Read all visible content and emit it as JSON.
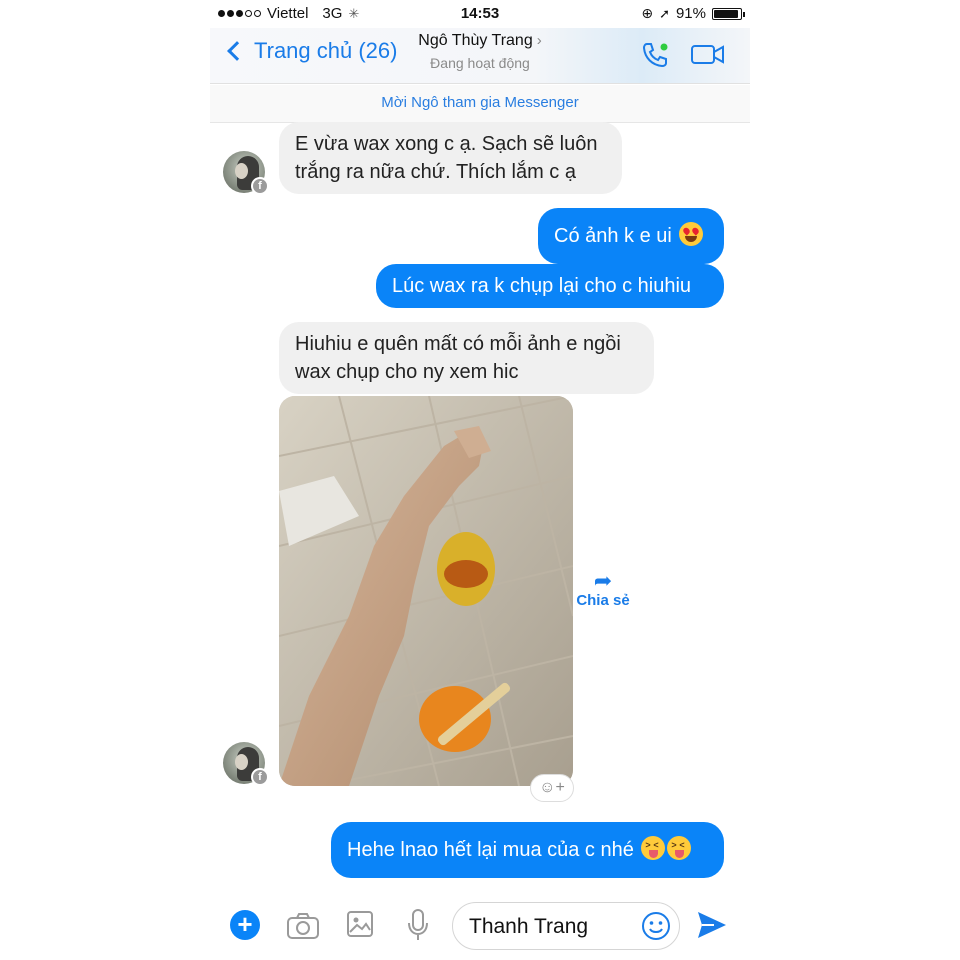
{
  "status_bar": {
    "carrier": "Viettel",
    "network": "3G",
    "time": "14:53",
    "battery_text": "91%",
    "battery_level": 0.91
  },
  "nav": {
    "back_label": "Trang chủ (26)",
    "contact_name": "Ngô Thùy Trang",
    "contact_status": "Đang hoạt động",
    "accent_color": "#1a7ce8"
  },
  "invite_text": "Mời Ngô tham gia Messenger",
  "messages": [
    {
      "from": "them",
      "lines": [
        "E vừa wax xong c ạ. Sạch sẽ luôn",
        "trắng ra nữa chứ. Thích lắm c ạ"
      ]
    },
    {
      "from": "me",
      "text": "Có ảnh k e ui",
      "emoji": "heart-eyes"
    },
    {
      "from": "me",
      "text": "Lúc wax ra k chụp lại cho c hiuhiu"
    },
    {
      "from": "them",
      "lines": [
        "Hiuhiu e quên mất có mỗi ảnh e ngồi",
        "wax chụp cho ny xem hic"
      ]
    },
    {
      "from": "them",
      "type": "photo"
    },
    {
      "from": "me",
      "text": "Hehe lnao hết lại mua của c nhé",
      "emoji": "squinting-tongue x2"
    }
  ],
  "share_label": "Chia sẻ",
  "composer": {
    "input_value": "Thanh Trang"
  },
  "colors": {
    "outgoing_bubble": "#0a84f8",
    "incoming_bubble": "#f0f0f0"
  }
}
